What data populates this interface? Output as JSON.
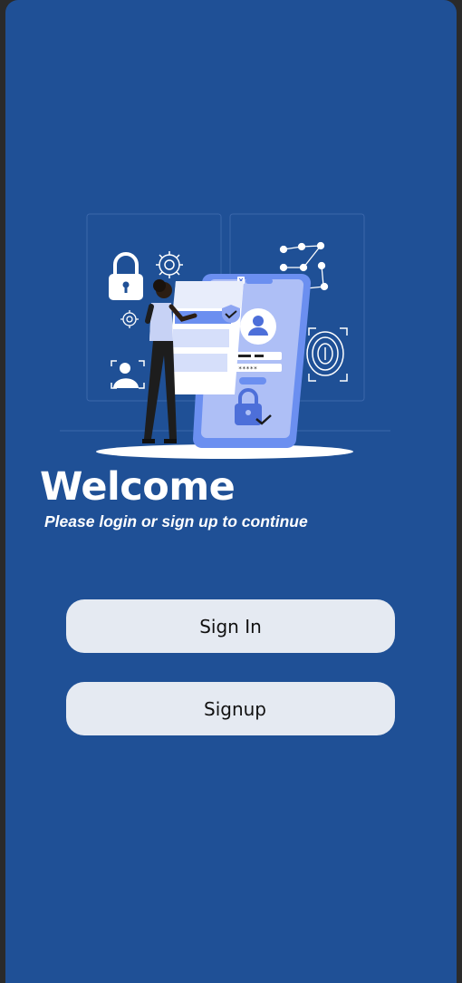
{
  "colors": {
    "background": "#1f5096",
    "button_background": "#e5eaf2",
    "text_primary": "#ffffff",
    "illustration_accent": "#6b8ff0"
  },
  "hero": {
    "title": "Welcome",
    "subtitle": "Please login or sign up to continue",
    "illustration_icon": "security-login-illustration"
  },
  "actions": {
    "signin_label": "Sign In",
    "signup_label": "Signup"
  }
}
